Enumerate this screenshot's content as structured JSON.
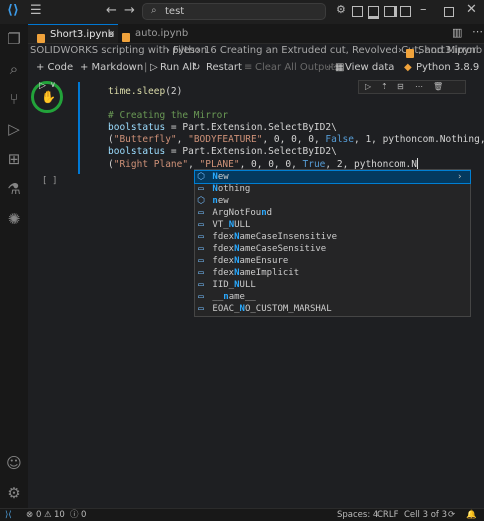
{
  "titlebar": {
    "search_text": "test"
  },
  "tabs": [
    {
      "label": "Short3.ipynb",
      "active": true
    },
    {
      "label": "auto.ipynb",
      "active": false
    }
  ],
  "breadcrumb": {
    "parts": [
      "SOLIDWORKS scripting with python",
      "Files",
      "16 Creating an Extruded cut, Revolved Cut, and Mirror",
      "Short3.ipynb"
    ]
  },
  "toolbar": {
    "code": "+ Code",
    "markdown": "+ Markdown",
    "run_all": "Run All",
    "restart": "Restart",
    "clear_outputs": "Clear All Outputs",
    "view_data": "View data",
    "kernel": "Python 3.8.9"
  },
  "code": {
    "l1_fn": "time.sleep",
    "l1_args": "(2)",
    "comment": "# Creating the Mirror",
    "l3_var": "boolstatus",
    "l3_rest": " = Part.Extension.SelectByID2\\",
    "l4_open": "(",
    "l4_str1": "\"Butterfly\"",
    "l4_sep1": ", ",
    "l4_str2": "\"BODYFEATURE\"",
    "l4_nums": ", 0, 0, 0, ",
    "l4_kw": "False",
    "l4_tail": ", 1, pythoncom.Nothing, 0)",
    "l5_var": "boolstatus",
    "l5_rest": " = Part.Extension.SelectByID2\\",
    "l6_open": "(",
    "l6_str": "\"Right Plane\"",
    "l6_sep": ", ",
    "l6_str2": "\"PLANE\"",
    "l6_nums": ", 0, 0, 0, ",
    "l6_kw": "True",
    "l6_tail": ", 2, pythoncom.N"
  },
  "cell_exec_empty": "[ ]",
  "suggestions": [
    {
      "pre": "",
      "hl": "N",
      "post": "ew",
      "icon": "cube-icon",
      "selected": true
    },
    {
      "pre": "",
      "hl": "N",
      "post": "othing",
      "icon": "variable-icon",
      "selected": false
    },
    {
      "pre": "",
      "hl": "n",
      "post": "ew",
      "icon": "cube-icon",
      "selected": false
    },
    {
      "pre": "ArgNotFou",
      "hl": "n",
      "post": "d",
      "icon": "variable-icon",
      "selected": false
    },
    {
      "pre": "VT_",
      "hl": "N",
      "post": "ULL",
      "icon": "variable-icon",
      "selected": false
    },
    {
      "pre": "fdex",
      "hl": "N",
      "post": "ameCaseInsensitive",
      "icon": "variable-icon",
      "selected": false
    },
    {
      "pre": "fdex",
      "hl": "N",
      "post": "ameCaseSensitive",
      "icon": "variable-icon",
      "selected": false
    },
    {
      "pre": "fdex",
      "hl": "N",
      "post": "ameEnsure",
      "icon": "variable-icon",
      "selected": false
    },
    {
      "pre": "fdex",
      "hl": "N",
      "post": "ameImplicit",
      "icon": "variable-icon",
      "selected": false
    },
    {
      "pre": "IID_",
      "hl": "N",
      "post": "ULL",
      "icon": "variable-icon",
      "selected": false
    },
    {
      "pre": "__",
      "hl": "n",
      "post": "ame__",
      "icon": "variable-icon",
      "selected": false
    },
    {
      "pre": "EOAC_",
      "hl": "N",
      "post": "O_CUSTOM_MARSHAL",
      "icon": "variable-icon",
      "selected": false
    }
  ],
  "statusbar": {
    "errors": "0",
    "warnings": "10",
    "info": "0",
    "spaces": "Spaces: 4",
    "eol": "CRLF",
    "cell": "Cell 3 of 3"
  }
}
